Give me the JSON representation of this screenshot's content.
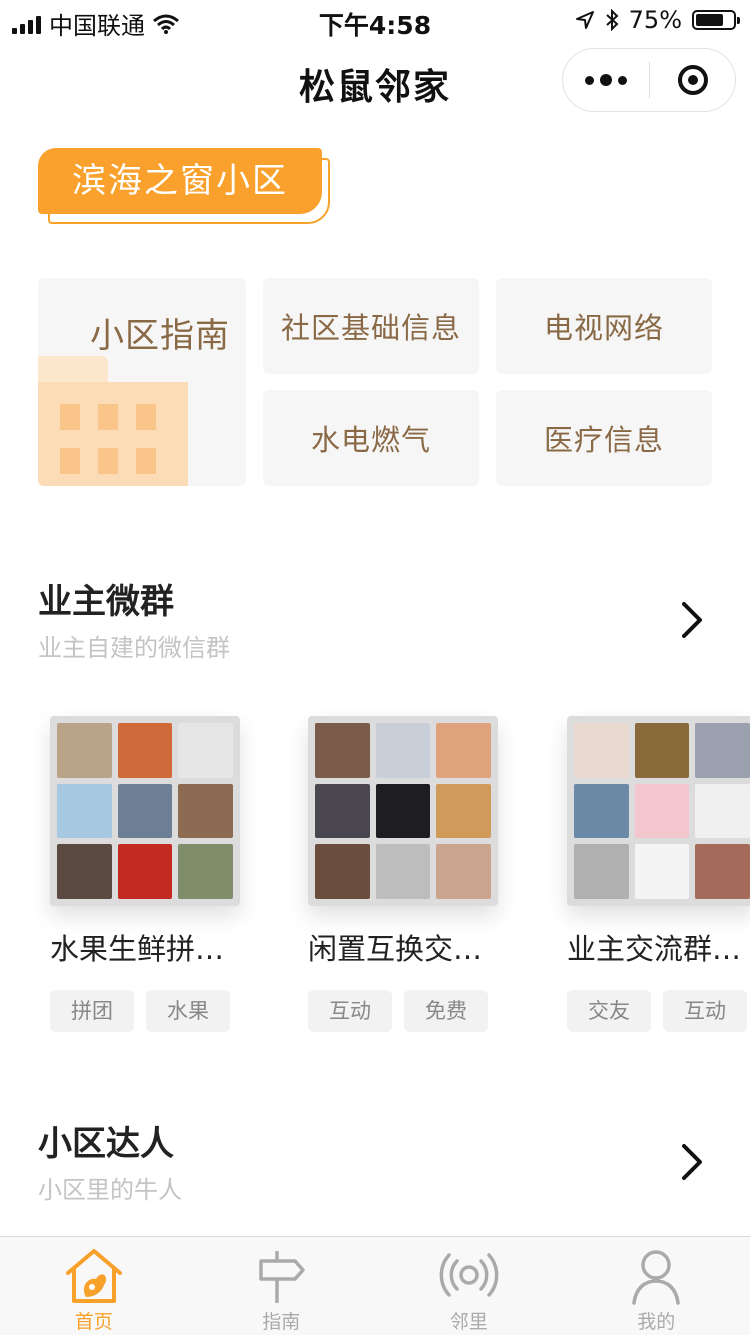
{
  "status_bar": {
    "carrier": "中国联通",
    "time": "下午4:58",
    "battery": "75%",
    "battery_level": 0.75
  },
  "nav": {
    "title": "松鼠邻家"
  },
  "community": {
    "name": "滨海之窗小区"
  },
  "guide": {
    "main_label": "小区指南",
    "items": [
      "社区基础信息",
      "电视网络",
      "水电燃气",
      "医疗信息"
    ]
  },
  "owner_groups": {
    "title": "业主微群",
    "subtitle": "业主自建的微信群",
    "groups": [
      {
        "name": "水果生鲜拼…",
        "tags": [
          "拼团",
          "水果"
        ]
      },
      {
        "name": "闲置互换交…",
        "tags": [
          "互动",
          "免费"
        ]
      },
      {
        "name": "业主交流群@…",
        "tags": [
          "交友",
          "互动"
        ]
      }
    ]
  },
  "experts": {
    "title": "小区达人",
    "subtitle": "小区里的牛人"
  },
  "tabbar": {
    "items": [
      {
        "label": "首页",
        "icon": "home-squirrel-icon",
        "active": true
      },
      {
        "label": "指南",
        "icon": "signpost-icon",
        "active": false
      },
      {
        "label": "邻里",
        "icon": "broadcast-icon",
        "active": false
      },
      {
        "label": "我的",
        "icon": "user-icon",
        "active": false
      }
    ]
  },
  "colors": {
    "accent": "#f9a12c",
    "tile_bg": "#f6f6f6",
    "tile_text": "#8a6a46"
  }
}
